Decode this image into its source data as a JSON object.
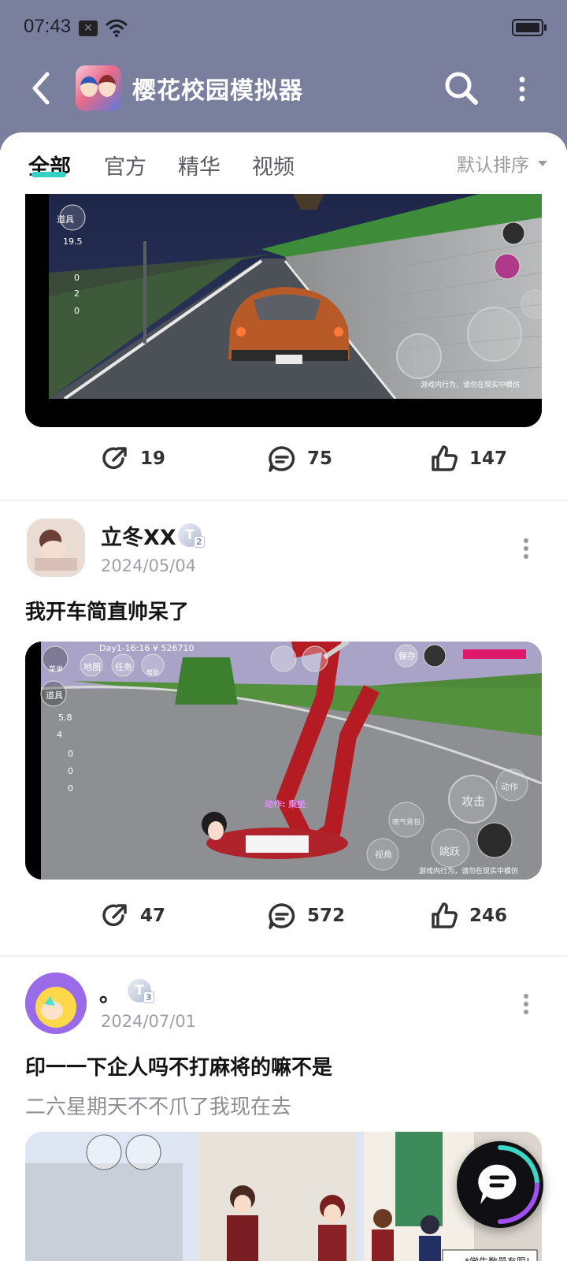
{
  "status_bar": {
    "time": "07:43"
  },
  "header": {
    "title": "樱花校园模拟器"
  },
  "tabs": [
    {
      "label": "全部",
      "active": true
    },
    {
      "label": "官方",
      "active": false
    },
    {
      "label": "精华",
      "active": false
    },
    {
      "label": "视频",
      "active": false
    }
  ],
  "sort": {
    "label": "默认排序"
  },
  "posts": [
    {
      "shares": "19",
      "comments": "75",
      "likes": "147",
      "hud": {
        "tools": "道具",
        "stat1": "19.5",
        "c1": "0",
        "c2": "2",
        "c3": "0",
        "warn": "游戏内行为，请勿在现实中模仿"
      }
    },
    {
      "username": "立冬XX",
      "level": "T",
      "level_sub": "2",
      "date": "2024/05/04",
      "title": "我开车简直帅呆了",
      "shares": "47",
      "comments": "572",
      "likes": "246",
      "hud": {
        "topline": "Day1-16:16 ¥ 526710",
        "menu": "菜单",
        "map": "地图",
        "task": "任务",
        "help": "帮助",
        "tools": "道具",
        "stat1": "5.8",
        "stat2": "4",
        "c1": "0",
        "c2": "0",
        "c3": "0",
        "save": "保存",
        "action_label": "动作: 乘坐",
        "attack": "攻击",
        "jump": "跳跃",
        "view": "视角",
        "action": "动作",
        "jet": "喷气背包",
        "warn": "游戏内行为，请勿在现实中模仿"
      }
    },
    {
      "username": "。",
      "level": "T",
      "level_sub": "3",
      "date": "2024/07/01",
      "title": "印一一下企人吗不打麻将的嘛不是",
      "body": "二六星期天不不爪了我现在去",
      "hud": {
        "notice": "*学生数量有限!"
      }
    }
  ],
  "colors": {
    "header_bg": "#7a7f9e",
    "accent": "#35d1c4"
  },
  "icons": [
    "back-arrow-icon",
    "search-icon",
    "more-vertical-icon",
    "share-icon",
    "comment-icon",
    "like-icon",
    "chat-fab-icon"
  ]
}
